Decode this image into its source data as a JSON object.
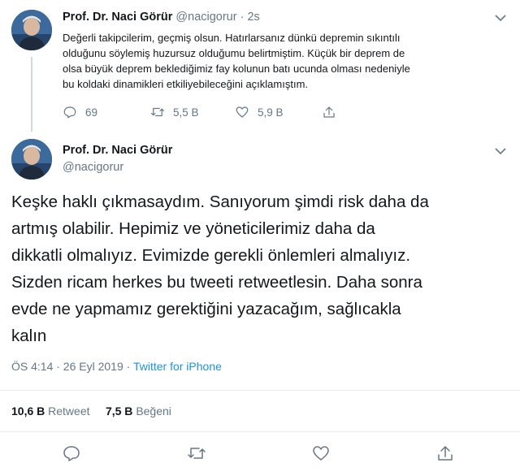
{
  "tweet1": {
    "name": "Prof. Dr. Naci Görür",
    "handle": "@nacigorur",
    "separator": " · ",
    "time": "2s",
    "lines": [
      "Değerli takipcilerim, geçmiş olsun. Hatırlarsanız dünkü depremin sıkıntılı",
      "olduğunu söylemiş huzursuz olduğumu belirtmiştim. Küçük bir deprem de",
      "olsa büyük deprem beklediğimiz fay kolunun batı ucunda olması nedeniyle",
      "bu koldaki dinamikleri etkiliyebileceğini açıklamıştım."
    ],
    "reply_count": "69",
    "retweet_count": "5,5 B",
    "like_count": "5,9 B"
  },
  "tweet2": {
    "name": "Prof. Dr. Naci Görür",
    "handle": "@nacigorur",
    "lines": [
      "Keşke haklı çıkmasaydım. Sanıyorum şimdi risk daha da",
      "artmış olabilir. Hepimiz ve yöneticilerimiz daha da",
      "dikkatli olmalıyız. Evimizde gerekli önlemleri almalıyız.",
      "Sizden ricam herkes bu tweeti retweetlesin. Daha sonra",
      "evde ne yapmamız gerektiğini yazacağım, sağlıcakla",
      "kalın"
    ],
    "timestamp": "ÖS 4:14 · 26 Eyl 2019 · ",
    "source": "Twitter for iPhone",
    "retweets": "10,6 B",
    "retweets_label": "Retweet",
    "likes": "7,5 B",
    "likes_label": "Beğeni"
  },
  "icons": {
    "reply": "reply-icon",
    "retweet": "retweet-icon",
    "like": "heart-icon",
    "share": "share-icon",
    "more": "chevron-down-icon"
  },
  "colors": {
    "text": "#14171a",
    "secondary": "#657786",
    "link": "#1b95e0",
    "divider": "#e6ecf0"
  }
}
